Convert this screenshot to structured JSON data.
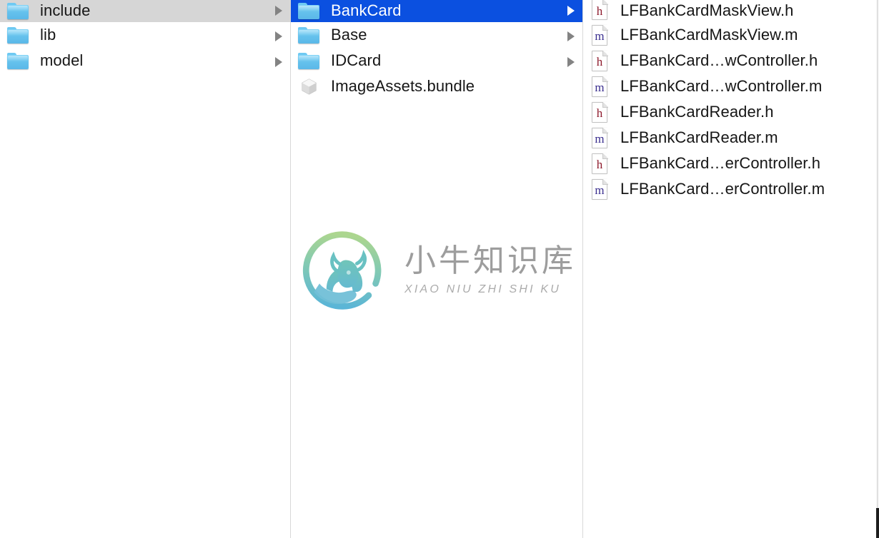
{
  "window": {
    "view_mode": "column-view",
    "accent_color": "#0b50e0",
    "selection_gray": "#d6d6d6"
  },
  "columns": [
    {
      "name": "column-1",
      "items": [
        {
          "label": "include",
          "icon": "folder-icon",
          "kind": "folder",
          "has_arrow": true,
          "selected": "gray"
        },
        {
          "label": "lib",
          "icon": "folder-icon",
          "kind": "folder",
          "has_arrow": true,
          "selected": "none"
        },
        {
          "label": "model",
          "icon": "folder-icon",
          "kind": "folder",
          "has_arrow": true,
          "selected": "none"
        }
      ]
    },
    {
      "name": "column-2",
      "items": [
        {
          "label": "BankCard",
          "icon": "folder-icon",
          "kind": "folder",
          "has_arrow": true,
          "selected": "blue"
        },
        {
          "label": "Base",
          "icon": "folder-icon",
          "kind": "folder",
          "has_arrow": true,
          "selected": "none"
        },
        {
          "label": "IDCard",
          "icon": "folder-icon",
          "kind": "folder",
          "has_arrow": true,
          "selected": "none"
        },
        {
          "label": "ImageAssets.bundle",
          "icon": "bundle-icon",
          "kind": "bundle",
          "has_arrow": false,
          "selected": "none"
        }
      ]
    },
    {
      "name": "column-3",
      "items": [
        {
          "label": "LFBankCardMaskView.h",
          "icon": "header-file-icon",
          "kind": "file",
          "glyph": "h",
          "has_arrow": false,
          "selected": "none"
        },
        {
          "label": "LFBankCardMaskView.m",
          "icon": "source-file-icon",
          "kind": "file",
          "glyph": "m",
          "has_arrow": false,
          "selected": "none"
        },
        {
          "label": "LFBankCard…wController.h",
          "icon": "header-file-icon",
          "kind": "file",
          "glyph": "h",
          "has_arrow": false,
          "selected": "none"
        },
        {
          "label": "LFBankCard…wController.m",
          "icon": "source-file-icon",
          "kind": "file",
          "glyph": "m",
          "has_arrow": false,
          "selected": "none"
        },
        {
          "label": "LFBankCardReader.h",
          "icon": "header-file-icon",
          "kind": "file",
          "glyph": "h",
          "has_arrow": false,
          "selected": "none"
        },
        {
          "label": "LFBankCardReader.m",
          "icon": "source-file-icon",
          "kind": "file",
          "glyph": "m",
          "has_arrow": false,
          "selected": "none"
        },
        {
          "label": "LFBankCard…erController.h",
          "icon": "header-file-icon",
          "kind": "file",
          "glyph": "h",
          "has_arrow": false,
          "selected": "none"
        },
        {
          "label": "LFBankCard…erController.m",
          "icon": "source-file-icon",
          "kind": "file",
          "glyph": "m",
          "has_arrow": false,
          "selected": "none"
        }
      ]
    }
  ],
  "watermark": {
    "chinese": "小牛知识库",
    "pinyin": "XIAO NIU ZHI SHI KU",
    "logo_gradient_start": "#a8d08a",
    "logo_gradient_end": "#5bb6d4"
  }
}
